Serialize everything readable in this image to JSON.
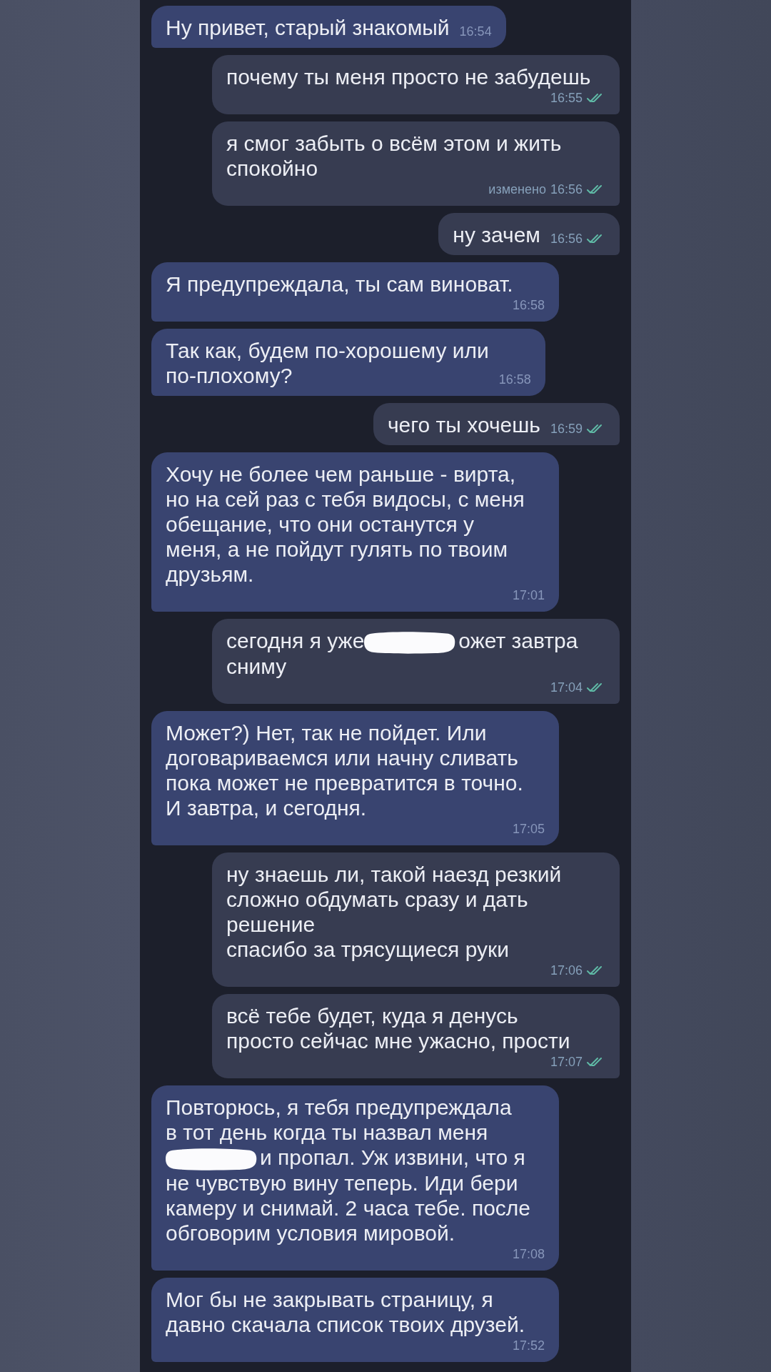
{
  "messages": [
    {
      "kind": "incoming",
      "text": "Ну привет, старый знакомый",
      "time": "16:54"
    },
    {
      "kind": "outgoing",
      "text": "почему ты меня просто не забудешь",
      "time": "16:55",
      "read": true
    },
    {
      "kind": "outgoing",
      "text": "я смог забыть о всём этом и жить\nспокойно",
      "edited_label": "изменено",
      "time": "16:56",
      "read": true
    },
    {
      "kind": "outgoing",
      "text": "ну зачем",
      "time": "16:56",
      "read": true
    },
    {
      "kind": "incoming",
      "text": "Я предупреждала, ты сам виноват.",
      "time": "16:58"
    },
    {
      "kind": "incoming",
      "text": "Так как, будем по-хорошему или\nпо-плохому?",
      "time": "16:58"
    },
    {
      "kind": "outgoing",
      "text": "чего ты хочешь",
      "time": "16:59",
      "read": true
    },
    {
      "kind": "incoming",
      "text": "Хочу не более чем раньше - вирта,\nно на сей раз с тебя видосы, с меня\nобещание, что они останутся у\nменя, а не пойдут гулять по твоим\nдрузьям.",
      "time": "17:01"
    },
    {
      "kind": "outgoing",
      "blocks": [
        {
          "kind": "line",
          "parts": [
            {
              "kind": "text",
              "text": "сегодня я уже"
            },
            {
              "kind": "redaction"
            },
            {
              "kind": "text",
              "text": "ожет завтра"
            }
          ]
        },
        {
          "kind": "text",
          "text": "сниму"
        }
      ],
      "time": "17:04",
      "read": true
    },
    {
      "kind": "incoming",
      "text": "Может?) Нет, так не пойдет. Или\nдоговариваемся или начну сливать\nпока может не превратится в точно.\nИ завтра, и сегодня.",
      "time": "17:05"
    },
    {
      "kind": "outgoing",
      "text": "ну знаешь ли, такой наезд резкий\nсложно обдумать сразу и дать\nрешение\nспасибо за трясущиеся руки",
      "time": "17:06",
      "read": true
    },
    {
      "kind": "outgoing",
      "text": "всё тебе будет, куда я денусь\nпросто сейчас мне ужасно, прости",
      "time": "17:07",
      "read": true
    },
    {
      "kind": "incoming",
      "blocks": [
        {
          "kind": "text",
          "text": "Повторюсь, я тебя предупреждала\nв тот день когда ты назвал меня"
        },
        {
          "kind": "line",
          "parts": [
            {
              "kind": "redaction"
            },
            {
              "kind": "text",
              "text": "и пропал. Уж извини, что я"
            }
          ]
        },
        {
          "kind": "text",
          "text": "не чувствую вину теперь. Иди бери\nкамеру и снимай. 2 часа тебе. после\nобговорим условия мировой."
        }
      ],
      "time": "17:08"
    },
    {
      "kind": "incoming",
      "text": "Мог бы не закрывать страницу, я\nдавно скачала список твоих друзей.",
      "time": "17:52"
    }
  ]
}
